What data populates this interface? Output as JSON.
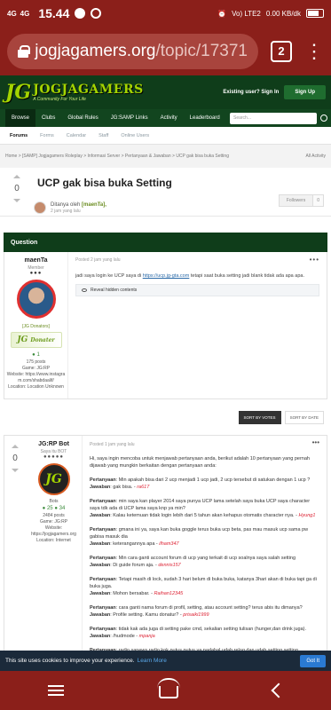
{
  "status_bar": {
    "signal1": "4G",
    "signal2": "4G",
    "time": "15.44",
    "net": "Vo) LTE2",
    "speed": "0.00 KB/dk"
  },
  "browser": {
    "url_domain": "jogjagamers.org",
    "url_path": "/topic/17371",
    "tab_count": "2"
  },
  "site": {
    "logo_mark": "JG",
    "logo_name": "JOGJAGAMERS",
    "logo_tagline": "A Community For Your Life",
    "existing_user": "Existing user? Sign In",
    "signup": "Sign Up"
  },
  "nav": {
    "items": [
      "Browse",
      "Clubs",
      "Global Rules",
      "JG:SAMP Links",
      "Activity",
      "Leaderboard"
    ],
    "search_placeholder": "Search..."
  },
  "subnav": {
    "items": [
      "Forums",
      "Forms",
      "Calendar",
      "Staff",
      "Online Users"
    ]
  },
  "breadcrumb": {
    "path": "Home > [SAMP] Jogjagamers Roleplay > Informasi Server > Pertanyaan & Jawaban > UCP gak bisa buka Setting",
    "all_activity": "All Activity"
  },
  "topic": {
    "vote": "0",
    "title": "UCP gak bisa buka Setting",
    "started_prefix": "Ditanya oleh",
    "started_user": "[maenTa],",
    "started_ago": "2 jam yang lalu",
    "follow": "Followers",
    "follow_count": "0"
  },
  "question_label": "Question",
  "post1": {
    "author": "maenTa",
    "rank": "Member",
    "pips": "●●●",
    "group": "[JG Donators]",
    "donater": "Donater",
    "rep": "1",
    "posts": "175 posts",
    "game": "Game: JG:RP",
    "website": "Website: https://www.instagram.com/shabdaalif/",
    "location": "Location: Location Unknown",
    "posted": "Posted 2 jam yang lalu",
    "body_pre": "jadi saya login ke UCP saya di",
    "body_link": "https://ucp.jg-gta.com",
    "body_post": "tetapi saat buka setting jadi blank tidak ada apa apa.",
    "reveal": "Reveal hidden contents"
  },
  "sort": {
    "by_votes": "SORT BY VOTES",
    "by_date": "SORT BY DATE"
  },
  "post2": {
    "vote": "0",
    "author": "JG:RP Bot",
    "rank": "Saya itu BOT",
    "pips": "●●●●●",
    "avatar_text": "JG",
    "role": "Bots",
    "rep1": "25",
    "rep2": "34",
    "posts": "2484 posts",
    "game": "Game: JG:RP",
    "website": "Website: https://jogjagamers.org",
    "location": "Location: Internet",
    "posted": "Posted 1 jam yang lalu",
    "intro": "Hi, saya ingin mencoba untuk menjawab pertanyaan anda, berikut adalah 10 pertanyaan yang pernah dijawab yang mungkin berkaitan dengan pertanyaan anda:",
    "qa": [
      {
        "q": "Min apakah bisa dari 2 ucp menjadi 1 ucp jadi, 2 ucp tersebut di satukan dengan 1 ucp ?",
        "a": "gak bisa.",
        "who": "ra617"
      },
      {
        "q": "min saya kan player 2014 saya punya UCP lama setelah saya buka UCP saya character saya tdk ada di UCP lama saya knp ya min?",
        "a": "Kalau ketemuan tidak login lebih dari 5 tahun akan kehapus otomatis character nya.",
        "who": "Hyung1"
      },
      {
        "q": "gmana ini ya, saya kan buka goggle terus buka ucp beta, pas mau masuk ucp sama pw gabisa masuk dia",
        "a": "keterangannya apa",
        "who": "ilham347"
      },
      {
        "q": "Min cara ganti account forum di ucp yang terkait di ucp soalnya saya salah setting",
        "a": "Di guide forum aja.",
        "who": "dennis157"
      },
      {
        "q": "Tetapi masih di lock, sudah 3 hari belum di buka buka, katanya 3hari akan di buka tapi ga di buka juga.",
        "a": "Mohon bersabar.",
        "who": "Raihan12345"
      },
      {
        "q": "cara ganti nama forum di profil, setting, atau account setting? terus abis itu dimanya?",
        "a": "Profile setting. Kamu donatur?",
        "who": "prisaiki1999"
      },
      {
        "q": "tidak kak ada juga di setting pake cmd, sekalian setting tulisan (hunger,dan drink juga).",
        "a": "/hudmode",
        "who": "mpanja"
      },
      {
        "q": "radio sanews radio kok putus putus ya,padahal udah relog,dan udah setting setting",
        "a": "",
        "who": ""
      }
    ]
  },
  "cookie": {
    "text": "This site uses cookies to improve your experience.",
    "learn": "Learn More",
    "got_it": "Got It"
  }
}
